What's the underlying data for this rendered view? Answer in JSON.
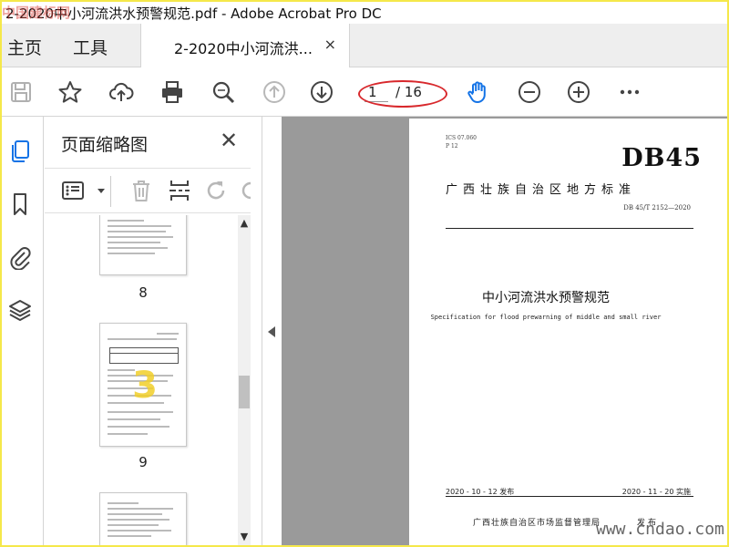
{
  "window": {
    "title": "2-2020中小河流洪水预警规范.pdf - Adobe Acrobat Pro DC",
    "watermark_top": "中国建标网"
  },
  "tabs": {
    "home": "主页",
    "tools": "工具",
    "document": "2-2020中小河流洪...",
    "close": "×"
  },
  "toolbar": {
    "current_page": "1",
    "total_pages": "/ 16",
    "icons": [
      "save-icon",
      "star-icon",
      "upload-icon",
      "print-icon",
      "zoom-search-icon",
      "prev-page-icon",
      "next-page-icon",
      "hand-icon",
      "zoom-out-icon",
      "zoom-in-icon",
      "more-icon"
    ],
    "accent_color": "#1473e6",
    "highlight_color": "#d8282c"
  },
  "sidebar": {
    "icons": [
      "pages-icon",
      "bookmark-icon",
      "attachment-icon",
      "layers-icon"
    ]
  },
  "thumbnails_panel": {
    "title": "页面缩略图",
    "close": "✕",
    "pages": [
      {
        "number": "8"
      },
      {
        "number": "9"
      }
    ]
  },
  "document": {
    "ics": "ICS 07.060",
    "p": "P 12",
    "code": "DB45",
    "standard_type": "广西壮族自治区地方标准",
    "standard_no": "DB 45/T 2152—2020",
    "title": "中小河流洪水预警规范",
    "title_en": "Specification for flood prewarning of middle and small river",
    "publish_date": "2020 - 10 - 12 发布",
    "effective_date": "2020 - 11 - 20 实施",
    "issuer": "广西壮族自治区市场监督管理局",
    "issue_word": "发布"
  },
  "watermark_bottom": "www.cndao.com"
}
